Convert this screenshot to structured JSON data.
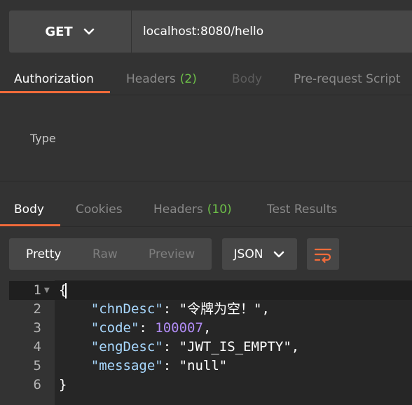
{
  "request": {
    "method": "GET",
    "url": "localhost:8080/hello"
  },
  "request_tabs": [
    {
      "label": "Authorization",
      "count": "",
      "state": "active"
    },
    {
      "label": "Headers",
      "count": "(2)",
      "state": "normal"
    },
    {
      "label": "Body",
      "count": "",
      "state": "disabled"
    },
    {
      "label": "Pre-request Script",
      "count": "",
      "state": "normal"
    }
  ],
  "auth": {
    "type_label": "Type"
  },
  "response_tabs": [
    {
      "label": "Body",
      "count": "",
      "state": "active"
    },
    {
      "label": "Cookies",
      "count": "",
      "state": "normal"
    },
    {
      "label": "Headers",
      "count": "(10)",
      "state": "normal"
    },
    {
      "label": "Test Results",
      "count": "",
      "state": "normal"
    }
  ],
  "view_modes": [
    "Pretty",
    "Raw",
    "Preview"
  ],
  "active_view_mode": "Pretty",
  "format": "JSON",
  "code_lines": [
    {
      "num": "1",
      "text": "{"
    },
    {
      "num": "2",
      "key": "\"chnDesc\"",
      "value": "\"令牌为空！\"",
      "value_type": "string",
      "trail": ","
    },
    {
      "num": "3",
      "key": "\"code\"",
      "value": "100007",
      "value_type": "number",
      "trail": ","
    },
    {
      "num": "4",
      "key": "\"engDesc\"",
      "value": "\"JWT_IS_EMPTY\"",
      "value_type": "string",
      "trail": ","
    },
    {
      "num": "5",
      "key": "\"message\"",
      "value": "\"null\"",
      "value_type": "string",
      "trail": ""
    },
    {
      "num": "6",
      "text": "}"
    }
  ],
  "colors": {
    "accent": "#f26b3a",
    "count_green": "#6dbf48",
    "json_key": "#a8d8ff",
    "json_number": "#b18cf5"
  },
  "icons": {
    "method_dropdown": "chevron-down-icon",
    "format_dropdown": "chevron-down-icon",
    "wrap": "wrap-lines-icon",
    "fold": "fold-caret-icon"
  }
}
